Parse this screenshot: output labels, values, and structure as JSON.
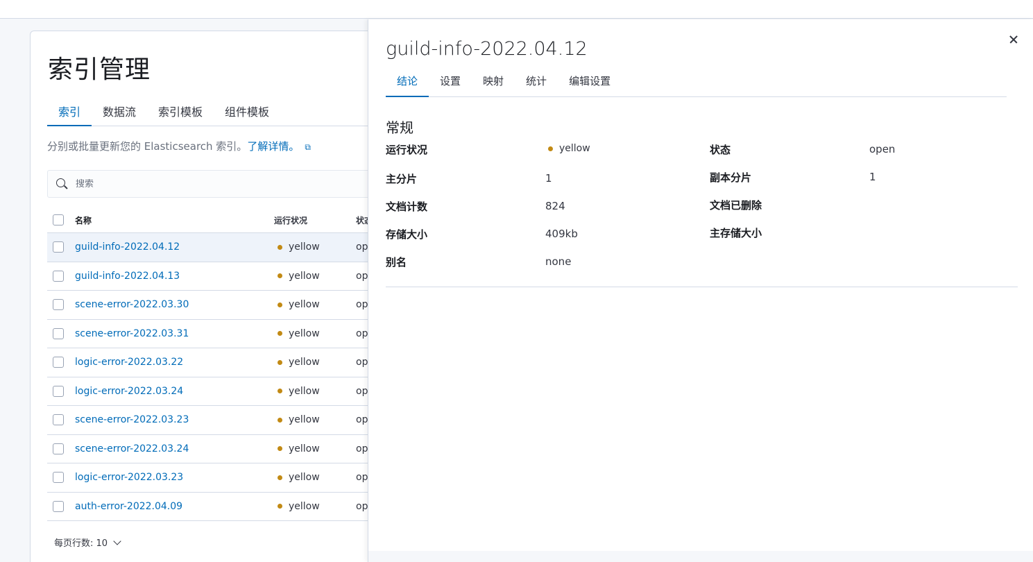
{
  "page": {
    "title": "索引管理",
    "tabs": [
      {
        "label": "索引",
        "active": true
      },
      {
        "label": "数据流",
        "active": false
      },
      {
        "label": "索引模板",
        "active": false
      },
      {
        "label": "组件模板",
        "active": false
      }
    ],
    "description": "分别或批量更新您的 Elasticsearch 索引。",
    "learn_more_link": "了解详情。",
    "search_placeholder": "搜索"
  },
  "table": {
    "columns": {
      "name": "名称",
      "health": "运行状况",
      "status": "状态"
    },
    "rows": [
      {
        "name": "guild-info-2022.04.12",
        "health": "yellow",
        "status": "open",
        "selected": true
      },
      {
        "name": "guild-info-2022.04.13",
        "health": "yellow",
        "status": "open",
        "selected": false
      },
      {
        "name": "scene-error-2022.03.30",
        "health": "yellow",
        "status": "open",
        "selected": false
      },
      {
        "name": "scene-error-2022.03.31",
        "health": "yellow",
        "status": "open",
        "selected": false
      },
      {
        "name": "logic-error-2022.03.22",
        "health": "yellow",
        "status": "open",
        "selected": false
      },
      {
        "name": "logic-error-2022.03.24",
        "health": "yellow",
        "status": "open",
        "selected": false
      },
      {
        "name": "scene-error-2022.03.23",
        "health": "yellow",
        "status": "open",
        "selected": false
      },
      {
        "name": "scene-error-2022.03.24",
        "health": "yellow",
        "status": "open",
        "selected": false
      },
      {
        "name": "logic-error-2022.03.23",
        "health": "yellow",
        "status": "open",
        "selected": false
      },
      {
        "name": "auth-error-2022.04.09",
        "health": "yellow",
        "status": "open",
        "selected": false
      }
    ],
    "rows_per_page_label": "每页行数: 10"
  },
  "flyout": {
    "title": "guild-info-2022.04.12",
    "tabs": [
      {
        "label": "结论",
        "active": true
      },
      {
        "label": "设置",
        "active": false
      },
      {
        "label": "映射",
        "active": false
      },
      {
        "label": "统计",
        "active": false
      },
      {
        "label": "编辑设置",
        "active": false
      }
    ],
    "section_title": "常规",
    "stats": {
      "health_label": "运行状况",
      "health_value": "yellow",
      "status_label": "状态",
      "status_value": "open",
      "primaries_label": "主分片",
      "primaries_value": "1",
      "replicas_label": "副本分片",
      "replicas_value": "1",
      "docs_count_label": "文档计数",
      "docs_count_value": "824",
      "docs_deleted_label": "文档已删除",
      "storage_size_label": "存储大小",
      "storage_size_value": "409kb",
      "primary_storage_label": "主存储大小",
      "aliases_label": "别名",
      "aliases_value": "none"
    }
  },
  "colors": {
    "accent": "#006bb8",
    "health_yellow": "#c28a14",
    "border": "#d3dae6"
  }
}
